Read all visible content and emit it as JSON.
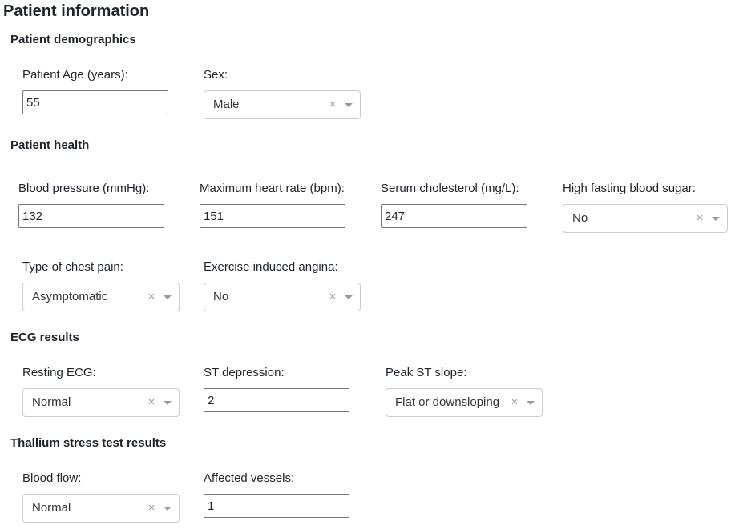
{
  "page": {
    "title": "Patient information"
  },
  "demographics": {
    "title": "Patient demographics",
    "age": {
      "label": "Patient Age (years):",
      "value": "55"
    },
    "sex": {
      "label": "Sex:",
      "value": "Male",
      "clear": "×"
    }
  },
  "health": {
    "title": "Patient health",
    "blood_pressure": {
      "label": "Blood pressure (mmHg):",
      "value": "132"
    },
    "max_heart_rate": {
      "label": "Maximum heart rate (bpm):",
      "value": "151"
    },
    "cholesterol": {
      "label": "Serum cholesterol (mg/L):",
      "value": "247"
    },
    "fasting_blood_sugar": {
      "label": "High fasting blood sugar:",
      "value": "No",
      "clear": "×"
    },
    "chest_pain": {
      "label": "Type of chest pain:",
      "value": "Asymptomatic",
      "clear": "×"
    },
    "exercise_angina": {
      "label": "Exercise induced angina:",
      "value": "No",
      "clear": "×"
    }
  },
  "ecg": {
    "title": "ECG results",
    "resting_ecg": {
      "label": "Resting ECG:",
      "value": "Normal",
      "clear": "×"
    },
    "st_depression": {
      "label": "ST depression:",
      "value": "2"
    },
    "peak_st_slope": {
      "label": "Peak ST slope:",
      "value": "Flat or downsloping",
      "clear": "×"
    }
  },
  "thallium": {
    "title": "Thallium stress test results",
    "blood_flow": {
      "label": "Blood flow:",
      "value": "Normal",
      "clear": "×"
    },
    "affected_vessels": {
      "label": "Affected vessels:",
      "value": "1"
    }
  },
  "icons": {
    "clear": "clear-x-icon",
    "dropdown": "caret-down-icon"
  },
  "colors": {
    "text": "#212529",
    "input_border": "#767676",
    "select_border": "#cccccc",
    "select_icon": "#999999"
  }
}
